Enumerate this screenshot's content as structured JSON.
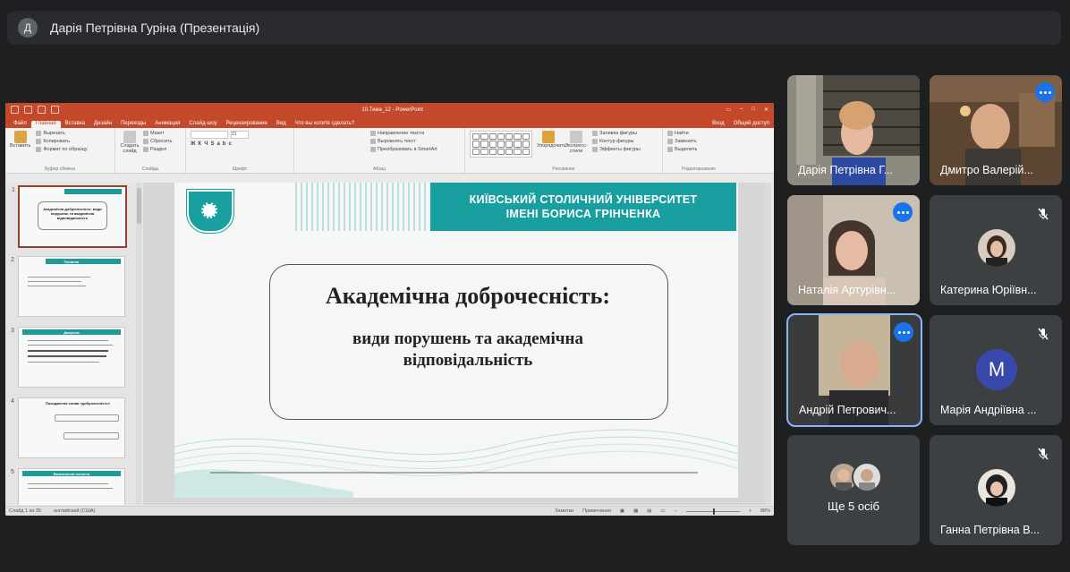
{
  "header": {
    "avatar_letter": "Д",
    "title": "Дарія Петрівна Гуріна (Презентація)"
  },
  "ppt": {
    "title_bar": "10.Тема_12 - PowerPoint",
    "menu": [
      "Файл",
      "Главная",
      "Вставка",
      "Дизайн",
      "Переходы",
      "Анимация",
      "Слайд-шоу",
      "Рецензирование",
      "Вид",
      "Что вы хотите сделать?"
    ],
    "menu_right": [
      "Вход",
      "Общий доступ"
    ],
    "ribbon": {
      "paste": "Вставить",
      "cut": "Вырезать",
      "copy": "Копировать",
      "format_painter": "Формат по образцу",
      "clipboard_group": "Буфер обмена",
      "new_slide": "Создать слайд",
      "layout": "Макет",
      "reset": "Сбросить",
      "section": "Раздел",
      "slides_group": "Слайды",
      "font_size": "21",
      "font_group": "Шрифт",
      "text_direction": "Направление текста",
      "align_text": "Выровнять текст",
      "smartart": "Преобразовать в SmartArt",
      "paragraph_group": "Абзац",
      "arrange": "Упорядочить",
      "quick_styles": "Экспресс-стили",
      "shape_fill": "Заливка фигуры",
      "shape_outline": "Контур фигуры",
      "shape_effects": "Эффекты фигуры",
      "drawing_group": "Рисование",
      "find": "Найти",
      "replace": "Заменить",
      "select": "Выделить",
      "editing_group": "Редактирование"
    },
    "thumbs": [
      {
        "num": "1",
        "text": "Академічна доброчесність: види порушень та академічна відповідальність"
      },
      {
        "num": "2",
        "text": "Питання"
      },
      {
        "num": "3",
        "text": "Джерела"
      },
      {
        "num": "4",
        "text": "Походження слова «доброчесність»"
      },
      {
        "num": "5",
        "text": "Визначення поняття"
      }
    ],
    "slide": {
      "banner_line1": "КИЇВСЬКИЙ СТОЛИЧНИЙ УНІВЕРСИТЕТ",
      "banner_line2": "ІМЕНІ БОРИСА ГРІНЧЕНКА",
      "title": "Академічна доброчесність:",
      "subtitle_line1": "види порушень та академічна",
      "subtitle_line2": "відповідальність"
    },
    "status": {
      "slide": "Слайд 1 из 35",
      "lang": "английский (США)",
      "notes": "Заметки",
      "comments": "Примечания",
      "zoom": "88%"
    }
  },
  "participants": [
    {
      "name": "Дарія Петрівна Г...",
      "state": "video"
    },
    {
      "name": "Дмитро Валерій...",
      "state": "speaking"
    },
    {
      "name": "Наталія Артурівн...",
      "state": "speaking"
    },
    {
      "name": "Катерина Юріївн...",
      "state": "muted"
    },
    {
      "name": "Андрій Петрович...",
      "state": "active"
    },
    {
      "name": "Марія Андріївна ...",
      "state": "muted",
      "initial": "M"
    },
    {
      "name": "Ще 5 осіб",
      "state": "more"
    },
    {
      "name": "Ганна Петрівна В...",
      "state": "muted"
    }
  ],
  "colors": {
    "ppt_accent": "#c4482a",
    "teal": "#1a9fa0",
    "meet_bg": "#1e1f21",
    "tile_bg": "#3c4043",
    "speak_blue": "#1a73e8"
  }
}
